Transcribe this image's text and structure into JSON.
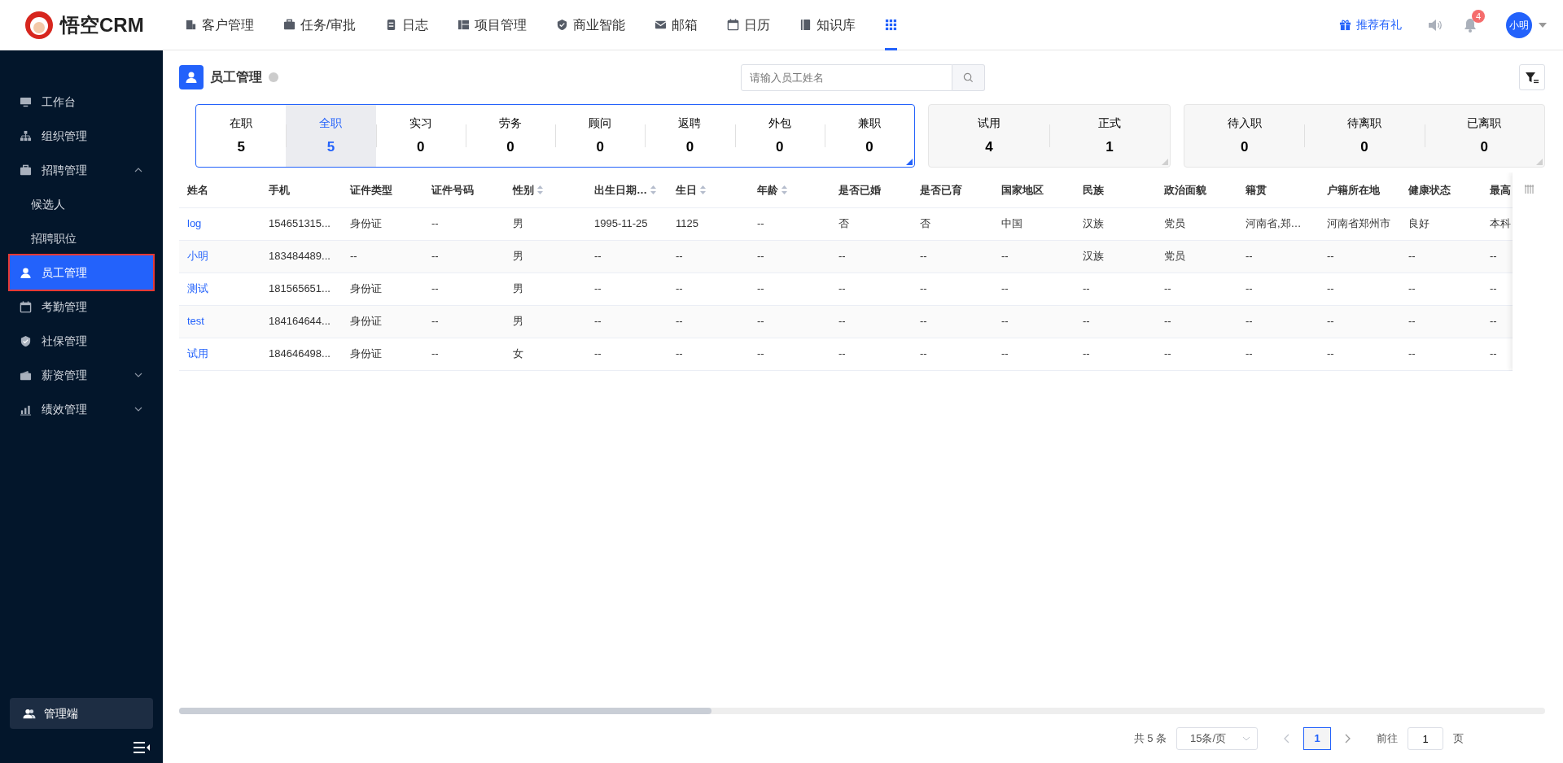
{
  "brand": {
    "logo_text": "悟空CRM"
  },
  "nav": [
    {
      "label": "客户管理",
      "kind": "building",
      "selected": false
    },
    {
      "label": "任务/审批",
      "kind": "briefcase",
      "selected": false
    },
    {
      "label": "日志",
      "kind": "note",
      "selected": false
    },
    {
      "label": "项目管理",
      "kind": "kanban",
      "selected": false
    },
    {
      "label": "商业智能",
      "kind": "shield",
      "selected": false
    },
    {
      "label": "邮箱",
      "kind": "mail",
      "selected": false
    },
    {
      "label": "日历",
      "kind": "calendar",
      "selected": false
    },
    {
      "label": "知识库",
      "kind": "book",
      "selected": false
    },
    {
      "kind": "apps",
      "selected": true
    }
  ],
  "header_right": {
    "referral": "推荐有礼",
    "notification_count": "4",
    "user": "小明"
  },
  "sidebar": {
    "items": [
      {
        "label": "工作台",
        "kind": "monitor",
        "selected": false
      },
      {
        "label": "组织管理",
        "kind": "sitemap",
        "selected": false
      },
      {
        "label": "招聘管理",
        "kind": "briefcase",
        "selected": false,
        "expanded": true,
        "children": [
          {
            "label": "候选人",
            "selected": false
          },
          {
            "label": "招聘职位",
            "selected": false
          }
        ]
      },
      {
        "label": "员工管理",
        "kind": "user",
        "selected": true
      },
      {
        "label": "考勤管理",
        "kind": "calendar",
        "selected": false
      },
      {
        "label": "社保管理",
        "kind": "shield",
        "selected": false
      },
      {
        "label": "薪资管理",
        "kind": "wallet",
        "selected": false,
        "expanded": false
      },
      {
        "label": "绩效管理",
        "kind": "chart",
        "selected": false,
        "expanded": false
      }
    ],
    "admin_button": "管理端"
  },
  "page": {
    "title": "员工管理",
    "search": {
      "placeholder": "请输入员工姓名"
    }
  },
  "stat_groups": [
    {
      "active": true,
      "items": [
        {
          "label": "在职",
          "value": "5",
          "selected": false
        },
        {
          "label": "全职",
          "value": "5",
          "selected": true
        },
        {
          "label": "实习",
          "value": "0",
          "selected": false
        },
        {
          "label": "劳务",
          "value": "0",
          "selected": false
        },
        {
          "label": "顾问",
          "value": "0",
          "selected": false
        },
        {
          "label": "返聘",
          "value": "0",
          "selected": false
        },
        {
          "label": "外包",
          "value": "0",
          "selected": false
        },
        {
          "label": "兼职",
          "value": "0",
          "selected": false
        }
      ]
    },
    {
      "active": false,
      "items": [
        {
          "label": "试用",
          "value": "4",
          "selected": false
        },
        {
          "label": "正式",
          "value": "1",
          "selected": false
        }
      ]
    },
    {
      "active": false,
      "items": [
        {
          "label": "待入职",
          "value": "0",
          "selected": false
        },
        {
          "label": "待离职",
          "value": "0",
          "selected": false
        },
        {
          "label": "已离职",
          "value": "0",
          "selected": false
        }
      ]
    }
  ],
  "table": {
    "columns": [
      {
        "label": "姓名",
        "sortable": false
      },
      {
        "label": "手机",
        "sortable": false
      },
      {
        "label": "证件类型",
        "sortable": false
      },
      {
        "label": "证件号码",
        "sortable": false
      },
      {
        "label": "性别",
        "sortable": true
      },
      {
        "label": "出生日期…",
        "sortable": true
      },
      {
        "label": "生日",
        "sortable": true
      },
      {
        "label": "年龄",
        "sortable": true
      },
      {
        "label": "是否已婚",
        "sortable": false
      },
      {
        "label": "是否已育",
        "sortable": false
      },
      {
        "label": "国家地区",
        "sortable": false
      },
      {
        "label": "民族",
        "sortable": false
      },
      {
        "label": "政治面貌",
        "sortable": false
      },
      {
        "label": "籍贯",
        "sortable": false
      },
      {
        "label": "户籍所在地",
        "sortable": false
      },
      {
        "label": "健康状态",
        "sortable": false
      },
      {
        "label": "最高"
      }
    ],
    "rows": [
      [
        "log",
        "154651315...",
        "身份证",
        "--",
        "男",
        "1995-11-25",
        "1125",
        "--",
        "否",
        "否",
        "中国",
        "汉族",
        "党员",
        "河南省,郑…",
        "河南省郑州市",
        "良好",
        "本科"
      ],
      [
        "小明",
        "183484489...",
        "--",
        "--",
        "男",
        "--",
        "--",
        "--",
        "--",
        "--",
        "--",
        "汉族",
        "党员",
        "--",
        "--",
        "--",
        "--"
      ],
      [
        "测试",
        "181565651...",
        "身份证",
        "--",
        "男",
        "--",
        "--",
        "--",
        "--",
        "--",
        "--",
        "--",
        "--",
        "--",
        "--",
        "--",
        "--"
      ],
      [
        "test",
        "184164644...",
        "身份证",
        "--",
        "男",
        "--",
        "--",
        "--",
        "--",
        "--",
        "--",
        "--",
        "--",
        "--",
        "--",
        "--",
        "--"
      ],
      [
        "试用",
        "184646498...",
        "身份证",
        "--",
        "女",
        "--",
        "--",
        "--",
        "--",
        "--",
        "--",
        "--",
        "--",
        "--",
        "--",
        "--",
        "--"
      ]
    ]
  },
  "pagination": {
    "total": "共 5 条",
    "page_size": "15条/页",
    "pages": [
      {
        "label": "1",
        "selected": true
      }
    ],
    "goto_label": "前往",
    "goto_value": "1",
    "goto_suffix": "页"
  }
}
